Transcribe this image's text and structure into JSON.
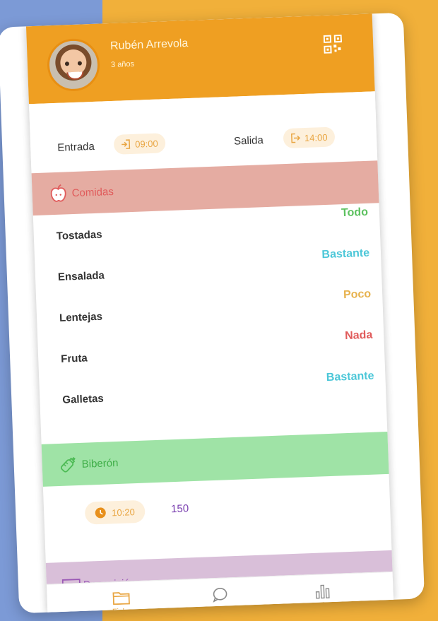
{
  "profile": {
    "name": "Rubén Arrevola",
    "age": "3 años"
  },
  "attendance": {
    "entrada_label": "Entrada",
    "entrada_time": "09:00",
    "salida_label": "Salida",
    "salida_time": "14:00"
  },
  "comidas": {
    "title": "Comidas",
    "items": [
      {
        "name": "Tostadas",
        "amount": "Todo",
        "color": "#5cc15f"
      },
      {
        "name": "Ensalada",
        "amount": "Bastante",
        "color": "#4cc7d8"
      },
      {
        "name": "Lentejas",
        "amount": "Poco",
        "color": "#e7b24e"
      },
      {
        "name": "Fruta",
        "amount": "Nada",
        "color": "#e05b5b"
      },
      {
        "name": "Galletas",
        "amount": "Bastante",
        "color": "#4cc7d8"
      }
    ]
  },
  "biberon": {
    "title": "Biberón",
    "time": "10:20",
    "amount": "150"
  },
  "deposicion": {
    "title": "Deposición"
  },
  "nav": {
    "ficha": "Ficha",
    "chat": "Chat",
    "estadisticas": "Estadísticas"
  },
  "colors": {
    "header": "#ef9f22",
    "comidas": "#e5aca2",
    "biberon": "#9fe3a6",
    "deposicion": "#d9bfd9",
    "accent": "#e9a643"
  }
}
